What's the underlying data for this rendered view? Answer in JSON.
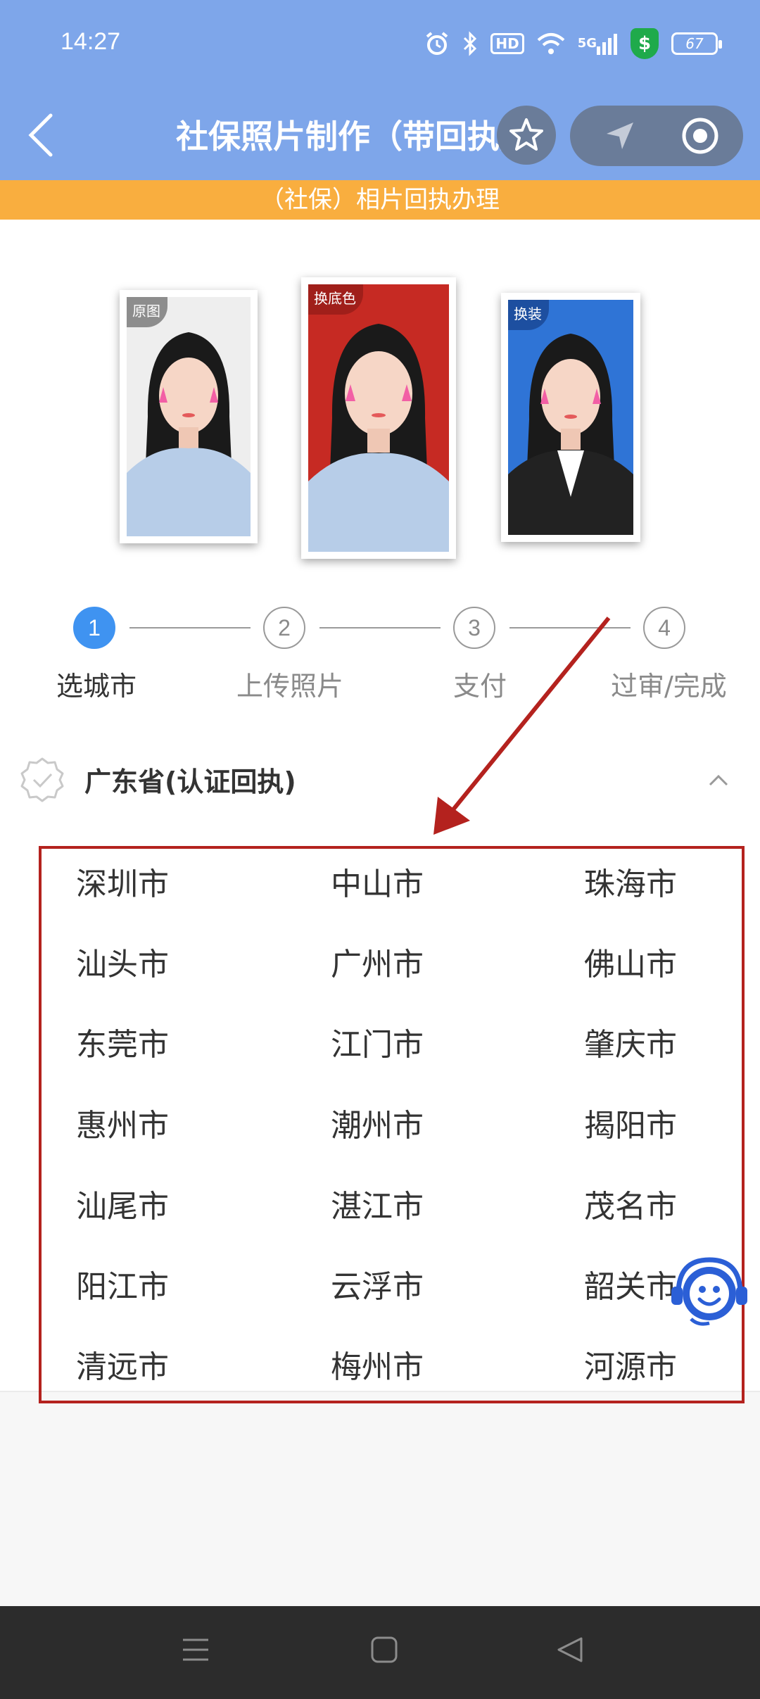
{
  "status_bar": {
    "time": "14:27",
    "hd_label": "HD",
    "network_label": "5G",
    "shield_symbol": "$",
    "battery": "67",
    "icons": [
      "alarm-icon",
      "bluetooth-icon",
      "hd-icon",
      "wifi-icon",
      "5g-signal-icon",
      "shield-icon",
      "battery-icon"
    ]
  },
  "header": {
    "title": "社保照片制作（带回执）",
    "banner": "（社保）相片回执办理"
  },
  "photos": [
    {
      "tag": "原图",
      "background": "#f0f0f0"
    },
    {
      "tag": "换底色",
      "background": "#c62a23"
    },
    {
      "tag": "换装",
      "background": "#2f74d6"
    }
  ],
  "steps": [
    {
      "number": "1",
      "label": "选城市"
    },
    {
      "number": "2",
      "label": "上传照片"
    },
    {
      "number": "3",
      "label": "支付"
    },
    {
      "number": "4",
      "label": "过审/完成"
    }
  ],
  "province": {
    "title": "广东省(认证回执)"
  },
  "cities": [
    [
      "深圳市",
      "中山市",
      "珠海市"
    ],
    [
      "汕头市",
      "广州市",
      "佛山市"
    ],
    [
      "东莞市",
      "江门市",
      "肇庆市"
    ],
    [
      "惠州市",
      "潮州市",
      "揭阳市"
    ],
    [
      "汕尾市",
      "湛江市",
      "茂名市"
    ],
    [
      "阳江市",
      "云浮市",
      "韶关市"
    ],
    [
      "清远市",
      "梅州市",
      "河源市"
    ]
  ],
  "colors": {
    "header_bg": "#7ea6ea",
    "banner_bg": "#f9ae3f",
    "active_step": "#3f93f1",
    "annotation_red": "#b4221e"
  }
}
